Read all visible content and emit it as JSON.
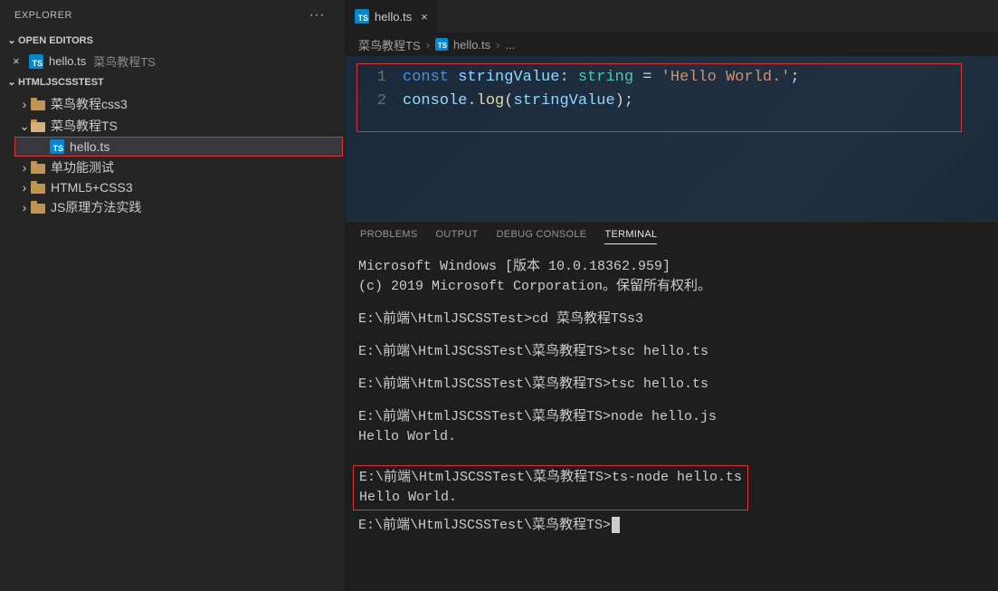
{
  "explorer": {
    "title": "EXPLORER",
    "openEditors": {
      "label": "OPEN EDITORS",
      "items": [
        {
          "file": "hello.ts",
          "folder": "菜鸟教程TS"
        }
      ]
    },
    "workspace": {
      "label": "HTMLJSCSSTEST",
      "tree": [
        {
          "name": "菜鸟教程css3",
          "type": "folder",
          "expanded": false
        },
        {
          "name": "菜鸟教程TS",
          "type": "folder",
          "expanded": true,
          "children": [
            {
              "name": "hello.ts",
              "type": "file-ts"
            }
          ]
        },
        {
          "name": "单功能测试",
          "type": "folder",
          "expanded": false
        },
        {
          "name": "HTML5+CSS3",
          "type": "folder",
          "expanded": false
        },
        {
          "name": "JS原理方法实践",
          "type": "folder",
          "expanded": false
        }
      ]
    }
  },
  "tabs": [
    {
      "file": "hello.ts"
    }
  ],
  "breadcrumb": {
    "parts": [
      "菜鸟教程TS",
      "hello.ts",
      "..."
    ]
  },
  "code": {
    "lines": [
      {
        "n": "1",
        "tokens": [
          {
            "t": "const ",
            "c": "c-kw"
          },
          {
            "t": "stringValue",
            "c": "c-var"
          },
          {
            "t": ": ",
            "c": "c-plain"
          },
          {
            "t": "string",
            "c": "c-type"
          },
          {
            "t": " = ",
            "c": "c-plain"
          },
          {
            "t": "'Hello World.'",
            "c": "c-str"
          },
          {
            "t": ";",
            "c": "c-plain"
          }
        ]
      },
      {
        "n": "2",
        "tokens": [
          {
            "t": "console",
            "c": "c-obj"
          },
          {
            "t": ".",
            "c": "c-plain"
          },
          {
            "t": "log",
            "c": "c-fn"
          },
          {
            "t": "(",
            "c": "c-plain"
          },
          {
            "t": "stringValue",
            "c": "c-var"
          },
          {
            "t": ")",
            "c": "c-plain"
          },
          {
            "t": ";",
            "c": "c-plain"
          }
        ]
      }
    ]
  },
  "panel": {
    "tabs": [
      "PROBLEMS",
      "OUTPUT",
      "DEBUG CONSOLE",
      "TERMINAL"
    ],
    "active": "TERMINAL",
    "terminal": {
      "header": [
        "Microsoft Windows [版本 10.0.18362.959]",
        "(c) 2019 Microsoft Corporation。保留所有权利。"
      ],
      "blocks": [
        [
          "E:\\前端\\HtmlJSCSSTest>cd 菜鸟教程TSs3"
        ],
        [
          "E:\\前端\\HtmlJSCSSTest\\菜鸟教程TS>tsc hello.ts"
        ],
        [
          "E:\\前端\\HtmlJSCSSTest\\菜鸟教程TS>tsc hello.ts"
        ],
        [
          "E:\\前端\\HtmlJSCSSTest\\菜鸟教程TS>node hello.js",
          "Hello World."
        ]
      ],
      "highlight": [
        "E:\\前端\\HtmlJSCSSTest\\菜鸟教程TS>ts-node hello.ts",
        "Hello World."
      ],
      "prompt": "E:\\前端\\HtmlJSCSSTest\\菜鸟教程TS>"
    }
  }
}
